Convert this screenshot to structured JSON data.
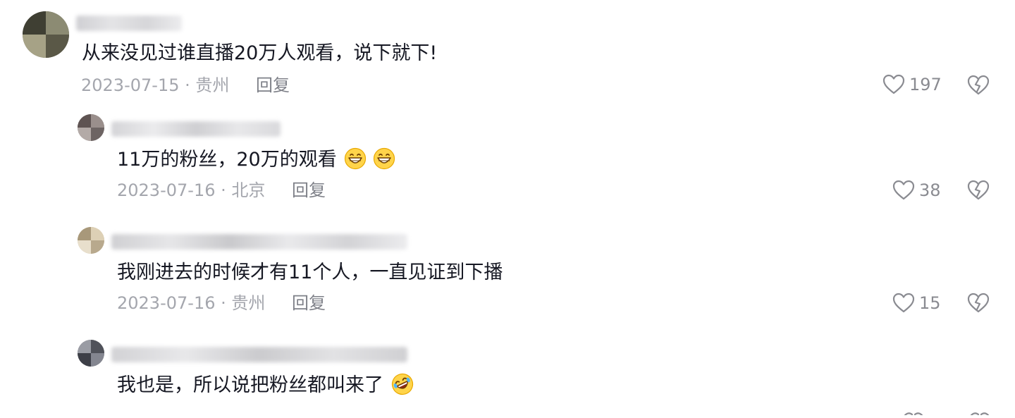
{
  "comments": [
    {
      "text": "从来没见过谁直播20万人观看，说下就下!",
      "date": "2023-07-15",
      "sep": "·",
      "location": "贵州",
      "reply_label": "回复",
      "likes": "197",
      "like_icon": "heart-outline-icon",
      "dislike_icon": "broken-heart-icon"
    },
    {
      "text": "11万的粉丝，20万的观看",
      "emojis": [
        "grin-emoji",
        "grin-emoji"
      ],
      "date": "2023-07-16",
      "sep": "·",
      "location": "北京",
      "reply_label": "回复",
      "likes": "38"
    },
    {
      "text": "我刚进去的时候才有11个人，一直见证到下播",
      "date": "2023-07-16",
      "sep": "·",
      "location": "贵州",
      "reply_label": "回复",
      "likes": "15"
    },
    {
      "text": "我也是，所以说把粉丝都叫来了",
      "emojis": [
        "rofl-emoji"
      ]
    }
  ],
  "colors": {
    "text": "#161823",
    "meta": "#a4a6ad",
    "icon": "#8a8b91"
  }
}
